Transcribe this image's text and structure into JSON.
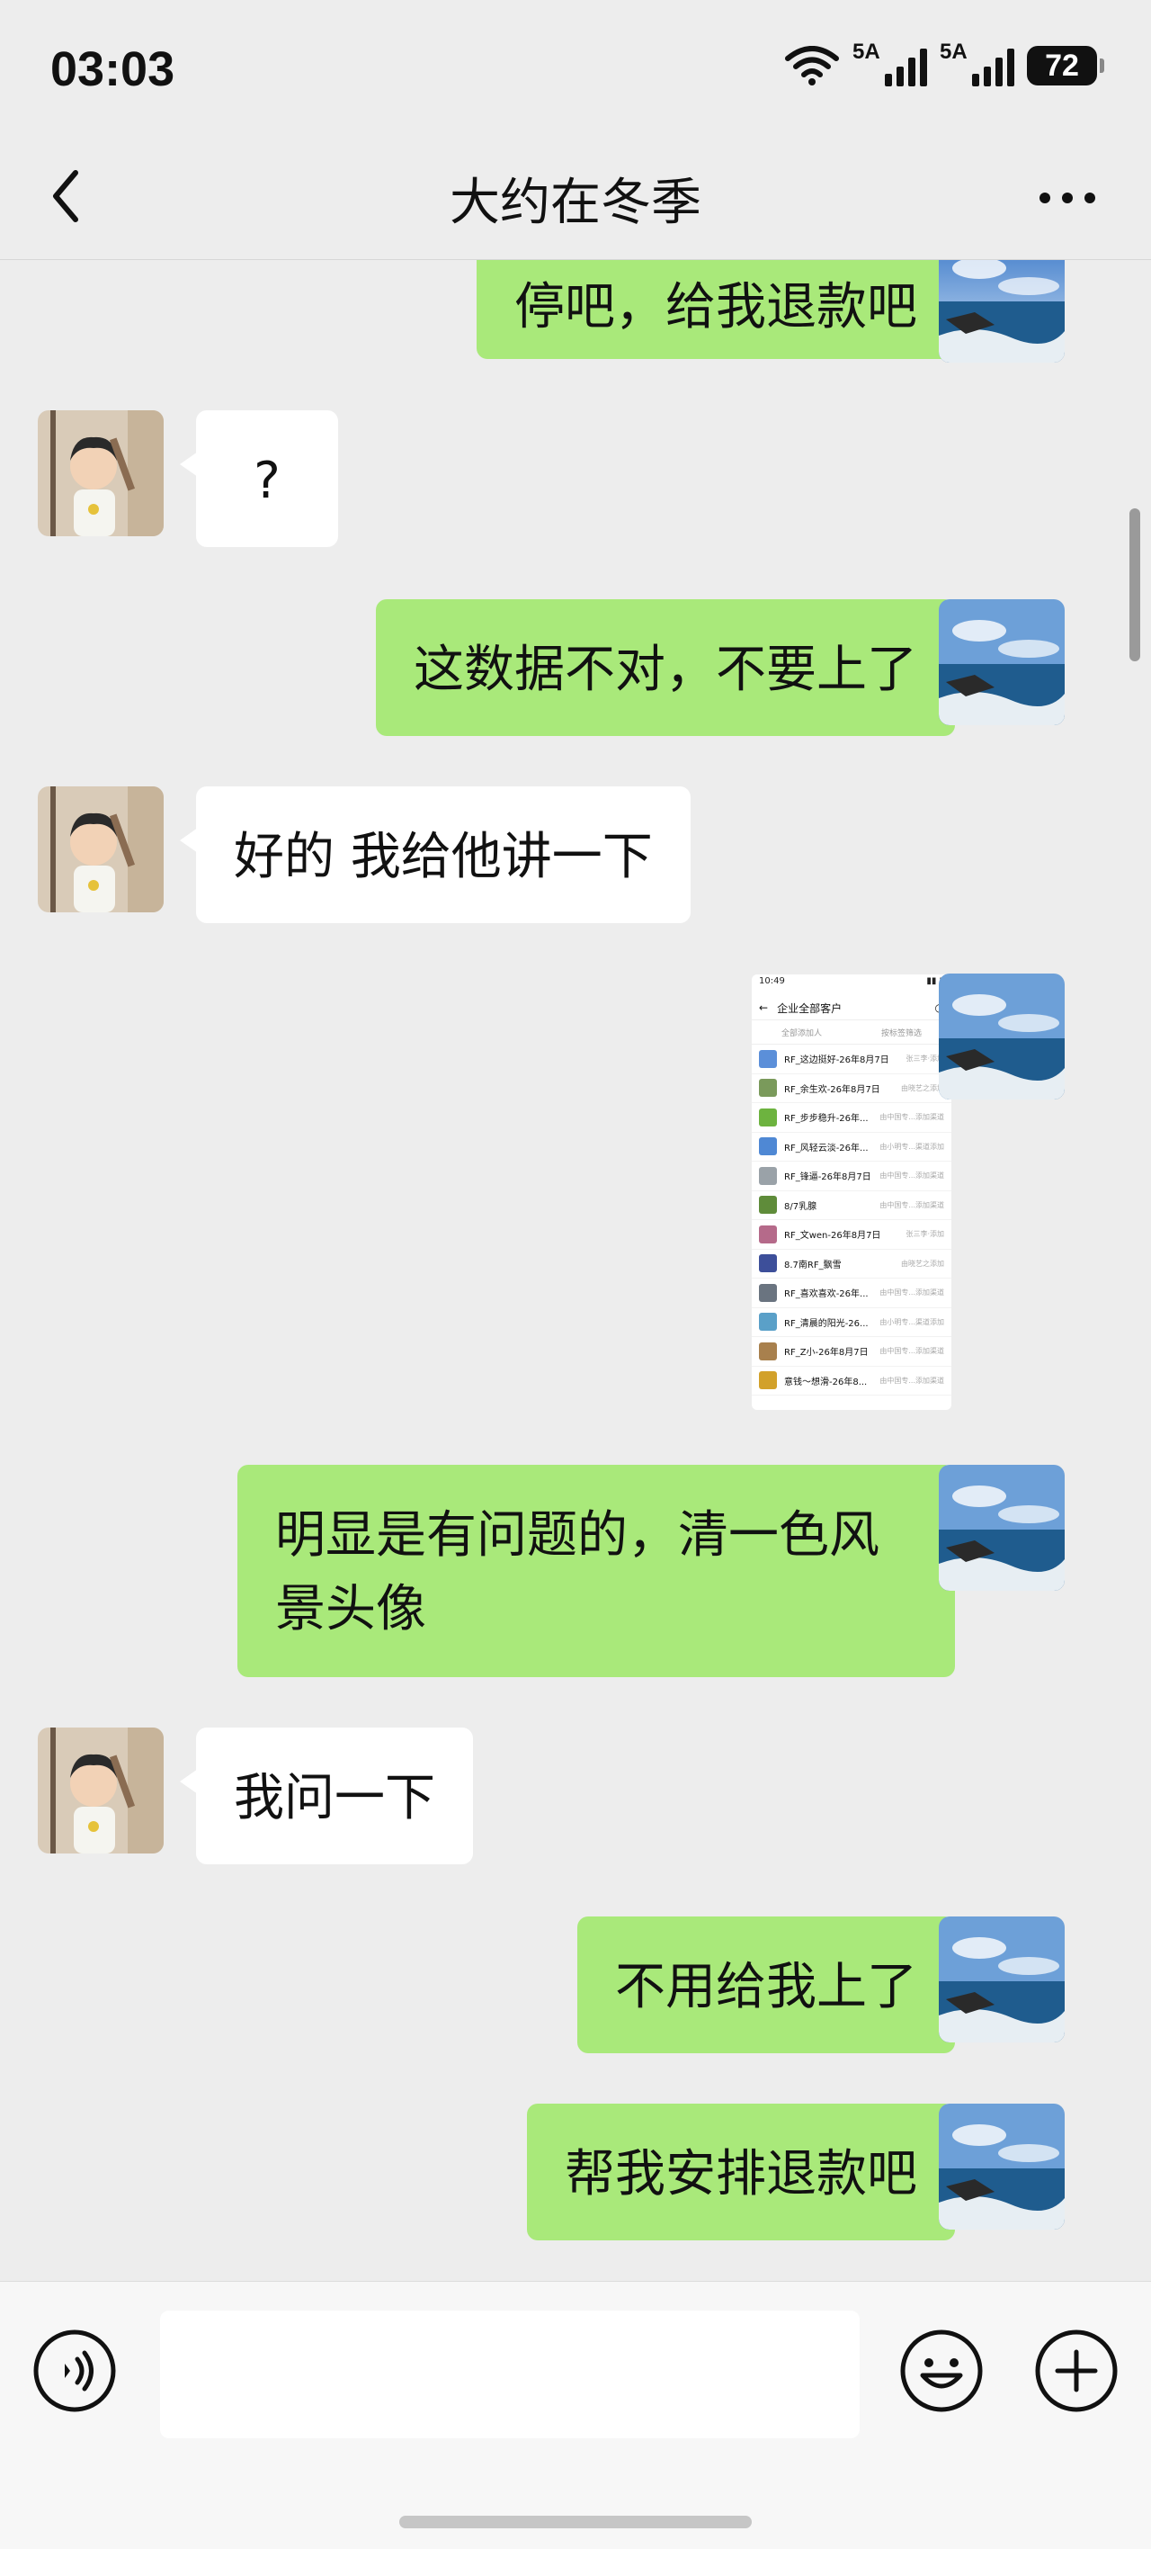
{
  "status_bar": {
    "time": "03:03",
    "signal1": "5A",
    "signal2": "5A",
    "battery": "72"
  },
  "header": {
    "title": "大约在冬季"
  },
  "messages": [
    {
      "sender": "me",
      "text": "停吧，给我退款吧"
    },
    {
      "sender": "them",
      "text": "?"
    },
    {
      "sender": "me",
      "text": "这数据不对，不要上了"
    },
    {
      "sender": "them",
      "text": "好的 我给他讲一下"
    },
    {
      "sender": "me",
      "type": "image"
    },
    {
      "sender": "me",
      "text": "明显是有问题的，清一色风景头像"
    },
    {
      "sender": "them",
      "text": "我问一下"
    },
    {
      "sender": "me",
      "text": "不用给我上了"
    },
    {
      "sender": "me",
      "text": "帮我安排退款吧"
    }
  ],
  "screenshot": {
    "time": "10:49",
    "title": "企业全部客户",
    "filter_left": "全部添加人",
    "filter_right": "按标签筛选",
    "rows": [
      {
        "name": "RF_这边挺好-26年8月7日",
        "right": "张三李·添加",
        "color": "#5b8fd9"
      },
      {
        "name": "RF_余生欢-26年8月7日",
        "right": "由晓艺之添加",
        "color": "#7a9a5b"
      },
      {
        "name": "RF_步步稳升-26年...",
        "right": "由中国专...添加渠道",
        "color": "#6db33f"
      },
      {
        "name": "RF_风轻云淡-26年...",
        "right": "由小明专...渠道添加",
        "color": "#4f88d4"
      },
      {
        "name": "RF_锋逼-26年8月7日",
        "right": "由中国专...添加渠道",
        "color": "#9aa2a8"
      },
      {
        "name": "8/7乳腺",
        "right": "由中国专...添加渠道",
        "color": "#5f8c3a"
      },
      {
        "name": "RF_文wen-26年8月7日",
        "right": "张三李·添加",
        "color": "#b56a8a"
      },
      {
        "name": "8.7南RF_飘雪",
        "right": "由晓艺之添加",
        "color": "#3d4f9a"
      },
      {
        "name": "RF_喜欢喜欢-26年...",
        "right": "由中国专...添加渠道",
        "color": "#6a7480"
      },
      {
        "name": "RF_清晨的阳光-26...",
        "right": "由小明专...渠道添加",
        "color": "#5aa0c8"
      },
      {
        "name": "RF_Z小-26年8月7日",
        "right": "由中国专...添加渠道",
        "color": "#a8804d"
      },
      {
        "name": "意钱～想滑-26年8...",
        "right": "由中国专...添加渠道",
        "color": "#d2a12a"
      }
    ]
  },
  "colors": {
    "my_bubble": "#a9e97a",
    "their_bubble": "#ffffff",
    "background": "#ededed"
  },
  "icons": {
    "back": "chevron-left-icon",
    "more": "more-dots-icon",
    "voice": "voice-icon",
    "emoji": "emoji-icon",
    "plus": "plus-icon"
  }
}
